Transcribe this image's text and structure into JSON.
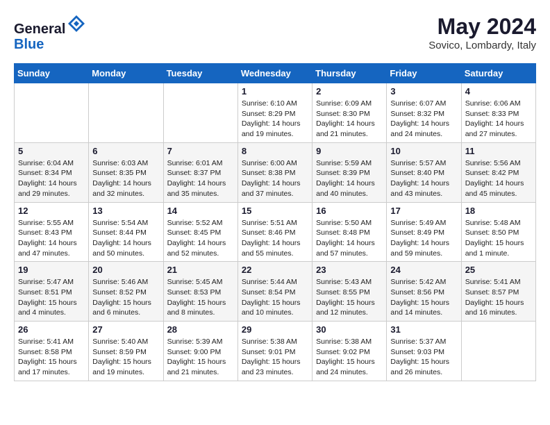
{
  "header": {
    "logo_line1": "General",
    "logo_line2": "Blue",
    "month_year": "May 2024",
    "location": "Sovico, Lombardy, Italy"
  },
  "weekdays": [
    "Sunday",
    "Monday",
    "Tuesday",
    "Wednesday",
    "Thursday",
    "Friday",
    "Saturday"
  ],
  "weeks": [
    [
      {
        "day": "",
        "info": ""
      },
      {
        "day": "",
        "info": ""
      },
      {
        "day": "",
        "info": ""
      },
      {
        "day": "1",
        "info": "Sunrise: 6:10 AM\nSunset: 8:29 PM\nDaylight: 14 hours\nand 19 minutes."
      },
      {
        "day": "2",
        "info": "Sunrise: 6:09 AM\nSunset: 8:30 PM\nDaylight: 14 hours\nand 21 minutes."
      },
      {
        "day": "3",
        "info": "Sunrise: 6:07 AM\nSunset: 8:32 PM\nDaylight: 14 hours\nand 24 minutes."
      },
      {
        "day": "4",
        "info": "Sunrise: 6:06 AM\nSunset: 8:33 PM\nDaylight: 14 hours\nand 27 minutes."
      }
    ],
    [
      {
        "day": "5",
        "info": "Sunrise: 6:04 AM\nSunset: 8:34 PM\nDaylight: 14 hours\nand 29 minutes."
      },
      {
        "day": "6",
        "info": "Sunrise: 6:03 AM\nSunset: 8:35 PM\nDaylight: 14 hours\nand 32 minutes."
      },
      {
        "day": "7",
        "info": "Sunrise: 6:01 AM\nSunset: 8:37 PM\nDaylight: 14 hours\nand 35 minutes."
      },
      {
        "day": "8",
        "info": "Sunrise: 6:00 AM\nSunset: 8:38 PM\nDaylight: 14 hours\nand 37 minutes."
      },
      {
        "day": "9",
        "info": "Sunrise: 5:59 AM\nSunset: 8:39 PM\nDaylight: 14 hours\nand 40 minutes."
      },
      {
        "day": "10",
        "info": "Sunrise: 5:57 AM\nSunset: 8:40 PM\nDaylight: 14 hours\nand 43 minutes."
      },
      {
        "day": "11",
        "info": "Sunrise: 5:56 AM\nSunset: 8:42 PM\nDaylight: 14 hours\nand 45 minutes."
      }
    ],
    [
      {
        "day": "12",
        "info": "Sunrise: 5:55 AM\nSunset: 8:43 PM\nDaylight: 14 hours\nand 47 minutes."
      },
      {
        "day": "13",
        "info": "Sunrise: 5:54 AM\nSunset: 8:44 PM\nDaylight: 14 hours\nand 50 minutes."
      },
      {
        "day": "14",
        "info": "Sunrise: 5:52 AM\nSunset: 8:45 PM\nDaylight: 14 hours\nand 52 minutes."
      },
      {
        "day": "15",
        "info": "Sunrise: 5:51 AM\nSunset: 8:46 PM\nDaylight: 14 hours\nand 55 minutes."
      },
      {
        "day": "16",
        "info": "Sunrise: 5:50 AM\nSunset: 8:48 PM\nDaylight: 14 hours\nand 57 minutes."
      },
      {
        "day": "17",
        "info": "Sunrise: 5:49 AM\nSunset: 8:49 PM\nDaylight: 14 hours\nand 59 minutes."
      },
      {
        "day": "18",
        "info": "Sunrise: 5:48 AM\nSunset: 8:50 PM\nDaylight: 15 hours\nand 1 minute."
      }
    ],
    [
      {
        "day": "19",
        "info": "Sunrise: 5:47 AM\nSunset: 8:51 PM\nDaylight: 15 hours\nand 4 minutes."
      },
      {
        "day": "20",
        "info": "Sunrise: 5:46 AM\nSunset: 8:52 PM\nDaylight: 15 hours\nand 6 minutes."
      },
      {
        "day": "21",
        "info": "Sunrise: 5:45 AM\nSunset: 8:53 PM\nDaylight: 15 hours\nand 8 minutes."
      },
      {
        "day": "22",
        "info": "Sunrise: 5:44 AM\nSunset: 8:54 PM\nDaylight: 15 hours\nand 10 minutes."
      },
      {
        "day": "23",
        "info": "Sunrise: 5:43 AM\nSunset: 8:55 PM\nDaylight: 15 hours\nand 12 minutes."
      },
      {
        "day": "24",
        "info": "Sunrise: 5:42 AM\nSunset: 8:56 PM\nDaylight: 15 hours\nand 14 minutes."
      },
      {
        "day": "25",
        "info": "Sunrise: 5:41 AM\nSunset: 8:57 PM\nDaylight: 15 hours\nand 16 minutes."
      }
    ],
    [
      {
        "day": "26",
        "info": "Sunrise: 5:41 AM\nSunset: 8:58 PM\nDaylight: 15 hours\nand 17 minutes."
      },
      {
        "day": "27",
        "info": "Sunrise: 5:40 AM\nSunset: 8:59 PM\nDaylight: 15 hours\nand 19 minutes."
      },
      {
        "day": "28",
        "info": "Sunrise: 5:39 AM\nSunset: 9:00 PM\nDaylight: 15 hours\nand 21 minutes."
      },
      {
        "day": "29",
        "info": "Sunrise: 5:38 AM\nSunset: 9:01 PM\nDaylight: 15 hours\nand 23 minutes."
      },
      {
        "day": "30",
        "info": "Sunrise: 5:38 AM\nSunset: 9:02 PM\nDaylight: 15 hours\nand 24 minutes."
      },
      {
        "day": "31",
        "info": "Sunrise: 5:37 AM\nSunset: 9:03 PM\nDaylight: 15 hours\nand 26 minutes."
      },
      {
        "day": "",
        "info": ""
      }
    ]
  ]
}
